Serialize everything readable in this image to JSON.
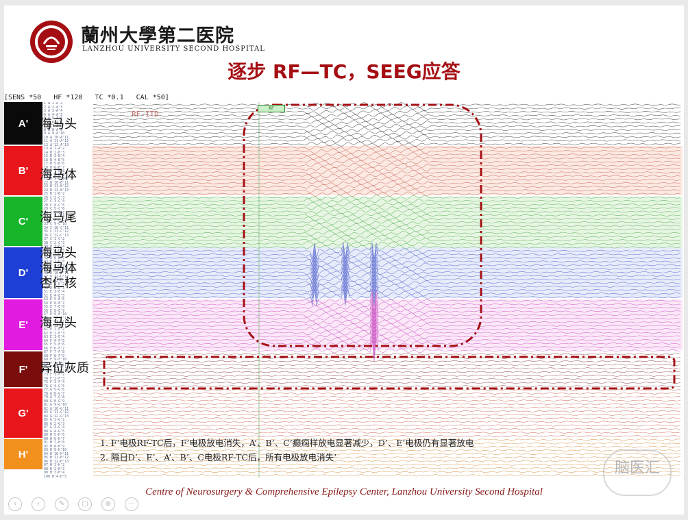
{
  "header": {
    "brand_cn": "蘭州大學第二医院",
    "brand_en": "LANZHOU UNIVERSITY  SECOND HOSPITAL",
    "title": "逐步 RF—TC，SEEG应答"
  },
  "eeg": {
    "settings": "[SENS *50   HF *120   TC *0.1   CAL *50]",
    "rf_label": "RF-ITD",
    "groups": [
      {
        "id": "A'",
        "color": "#0a0a0a",
        "label": "海马头"
      },
      {
        "id": "B'",
        "color": "#e8161b",
        "label": "海马体"
      },
      {
        "id": "C'",
        "color": "#16b52a",
        "label": "海马尾"
      },
      {
        "id": "D'",
        "color": "#1d3fd6",
        "label": "海马头\n海马体\n杏仁核"
      },
      {
        "id": "E'",
        "color": "#e21be0",
        "label": "海马头"
      },
      {
        "id": "F'",
        "color": "#7a0c0c",
        "label": "异位灰质"
      },
      {
        "id": "G'",
        "color": "#e8161b",
        "label": ""
      },
      {
        "id": "H'",
        "color": "#f2901e",
        "label": ""
      }
    ],
    "colors": {
      "highlight_box": "#a50f14",
      "tint_b": "#fbe9e2",
      "tint_c": "#e6f6e2",
      "tint_d": "#e7ecfb",
      "tint_e": "#fbe7f8"
    }
  },
  "notes": [
    "1.   F’电极RF-TC后，F’电极放电消失，A’、B’、C’癫痫样放电显著减少，D’、E’电极仍有显著放电",
    "2.   隔日D’、E’、A’、B’、C电极RF-TC后，所有电极放电消失’"
  ],
  "footer": {
    "text": "Centre  of  Neurosurgery & Comprehensive Epilepsy Center,  Lanzhou University Second Hospital"
  },
  "watermark": "脑医汇",
  "controls": [
    "prev-icon",
    "next-icon",
    "pen-icon",
    "screen-icon",
    "zoom-icon",
    "more-icon"
  ]
}
